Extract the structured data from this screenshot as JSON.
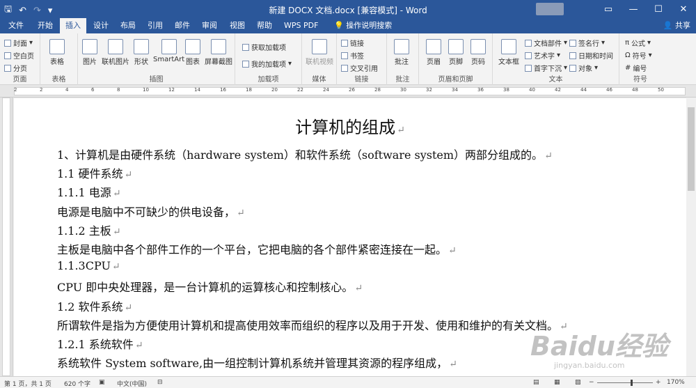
{
  "window": {
    "title": "新建 DOCX 文档.docx [兼容模式] - Word",
    "share": "共享"
  },
  "qat": {
    "save": "🖫",
    "undo": "↶",
    "redo": "↷",
    "more": "▾"
  },
  "winbtns": {
    "ribbon_opts": "▭",
    "min": "—",
    "max": "☐",
    "close": "✕"
  },
  "tabs": [
    "文件",
    "开始",
    "插入",
    "设计",
    "布局",
    "引用",
    "邮件",
    "审阅",
    "视图",
    "帮助",
    "WPS PDF",
    "操作说明搜索"
  ],
  "ribbon": {
    "pages": {
      "label": "页面",
      "cover": "封面",
      "blank": "空白页",
      "break": "分页"
    },
    "tables": {
      "label": "表格",
      "table": "表格"
    },
    "illustrations": {
      "label": "插图",
      "picture": "图片",
      "online": "联机图片",
      "shapes": "形状",
      "smartart": "SmartArt",
      "chart": "图表",
      "screenshot": "屏幕截图"
    },
    "addins": {
      "label": "加载项",
      "get": "获取加载项",
      "mine": "我的加载项"
    },
    "media": {
      "label": "媒体",
      "video": "联机视频"
    },
    "links": {
      "label": "链接",
      "link": "链接",
      "bookmark": "书签",
      "xref": "交叉引用"
    },
    "comments": {
      "label": "批注",
      "comment": "批注"
    },
    "header_footer": {
      "label": "页眉和页脚",
      "header": "页眉",
      "footer": "页脚",
      "page_number": "页码"
    },
    "text": {
      "label": "文本",
      "textbox": "文本框",
      "quick_parts": "文档部件",
      "wordart": "艺术字",
      "dropcap": "首字下沉",
      "signature": "签名行",
      "datetime": "日期和时间",
      "object": "对象"
    },
    "symbols": {
      "label": "符号",
      "equation": "公式",
      "symbol": "符号",
      "number": "编号"
    }
  },
  "ruler_numbers": [
    "2",
    "2",
    "4",
    "6",
    "8",
    "10",
    "12",
    "14",
    "16",
    "18",
    "20",
    "22",
    "24",
    "26",
    "28",
    "30",
    "32",
    "34",
    "36",
    "38",
    "40",
    "42",
    "44",
    "46",
    "48",
    "50"
  ],
  "document": {
    "title": "计算机的组成",
    "paragraphs": [
      "1、计算机是由硬件系统（hardware system）和软件系统（software system）两部分组成的。",
      "1.1 硬件系统",
      "1.1.1 电源",
      "电源是电脑中不可缺少的供电设备，",
      "1.1.2 主板",
      "主板是电脑中各个部件工作的一个平台，它把电脑的各个部件紧密连接在一起。",
      "1.1.3CPU",
      "CPU 即中央处理器，是一台计算机的运算核心和控制核心。",
      "1.2 软件系统",
      "所谓软件是指为方便使用计算机和提高使用效率而组织的程序以及用于开发、使用和维护的有关文档。",
      "1.2.1 系统软件",
      "系统软件 System software,由一组控制计算机系统并管理其资源的程序组成，"
    ],
    "paragraph_mark": "↵"
  },
  "status": {
    "page": "第 1 页，共 1 页",
    "words": "620 个字",
    "language": "中文(中国)",
    "zoom": "170%",
    "zoom_minus": "−",
    "zoom_plus": "+"
  },
  "watermark": {
    "brand": "Baidu经验",
    "url": "jingyan.baidu.com"
  }
}
